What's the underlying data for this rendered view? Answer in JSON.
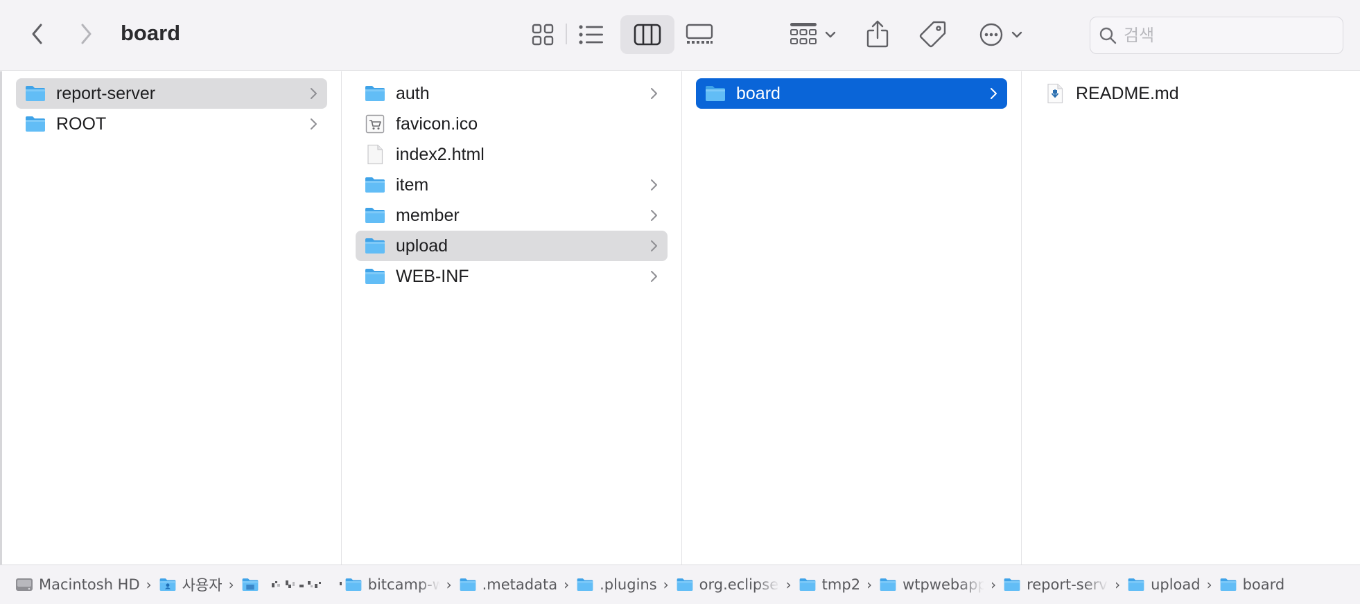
{
  "window": {
    "title": "board"
  },
  "toolbar": {
    "back": "back-chevron",
    "forward": "forward-chevron",
    "views": [
      "icon-view",
      "list-view",
      "column-view",
      "gallery-view"
    ],
    "active_view": "column-view",
    "group": "group-grid",
    "share": "share",
    "tags": "tag",
    "more": "ellipsis-circle"
  },
  "search": {
    "placeholder": "검색",
    "value": ""
  },
  "columns": [
    {
      "items": [
        {
          "name": "report-server",
          "kind": "folder",
          "state": "selected-inactive"
        },
        {
          "name": "ROOT",
          "kind": "folder",
          "state": "none"
        }
      ]
    },
    {
      "items": [
        {
          "name": "auth",
          "kind": "folder",
          "state": "none"
        },
        {
          "name": "favicon.ico",
          "kind": "image",
          "state": "none"
        },
        {
          "name": "index2.html",
          "kind": "document",
          "state": "none"
        },
        {
          "name": "item",
          "kind": "folder",
          "state": "none"
        },
        {
          "name": "member",
          "kind": "folder",
          "state": "none"
        },
        {
          "name": "upload",
          "kind": "folder",
          "state": "selected-inactive"
        },
        {
          "name": "WEB-INF",
          "kind": "folder",
          "state": "none"
        }
      ]
    },
    {
      "items": [
        {
          "name": "board",
          "kind": "folder",
          "state": "selected-active"
        }
      ]
    },
    {
      "items": [
        {
          "name": "README.md",
          "kind": "markdown",
          "state": "none"
        }
      ]
    }
  ],
  "pathbar": [
    {
      "label": "Macintosh HD",
      "icon": "disk-icon"
    },
    {
      "label": "사용자",
      "icon": "users-folder-icon"
    },
    {
      "label": "",
      "icon": "home-folder-icon",
      "redacted": true
    },
    {
      "label": "bitcamp-w",
      "icon": "folder-icon",
      "truncated": true
    },
    {
      "label": ".metadata",
      "icon": "folder-icon"
    },
    {
      "label": ".plugins",
      "icon": "folder-icon"
    },
    {
      "label": "org.eclipse",
      "icon": "folder-icon",
      "truncated": true
    },
    {
      "label": "tmp2",
      "icon": "folder-icon"
    },
    {
      "label": "wtpwebapp",
      "icon": "folder-icon",
      "truncated": true
    },
    {
      "label": "report-serv",
      "icon": "folder-icon",
      "truncated": true
    },
    {
      "label": "upload",
      "icon": "folder-icon"
    },
    {
      "label": "board",
      "icon": "folder-icon"
    }
  ],
  "colors": {
    "accent": "#0a65d8",
    "folder": "#5bb8f5",
    "selection_inactive": "#dcdcde",
    "toolbar_bg": "#f4f3f6"
  }
}
